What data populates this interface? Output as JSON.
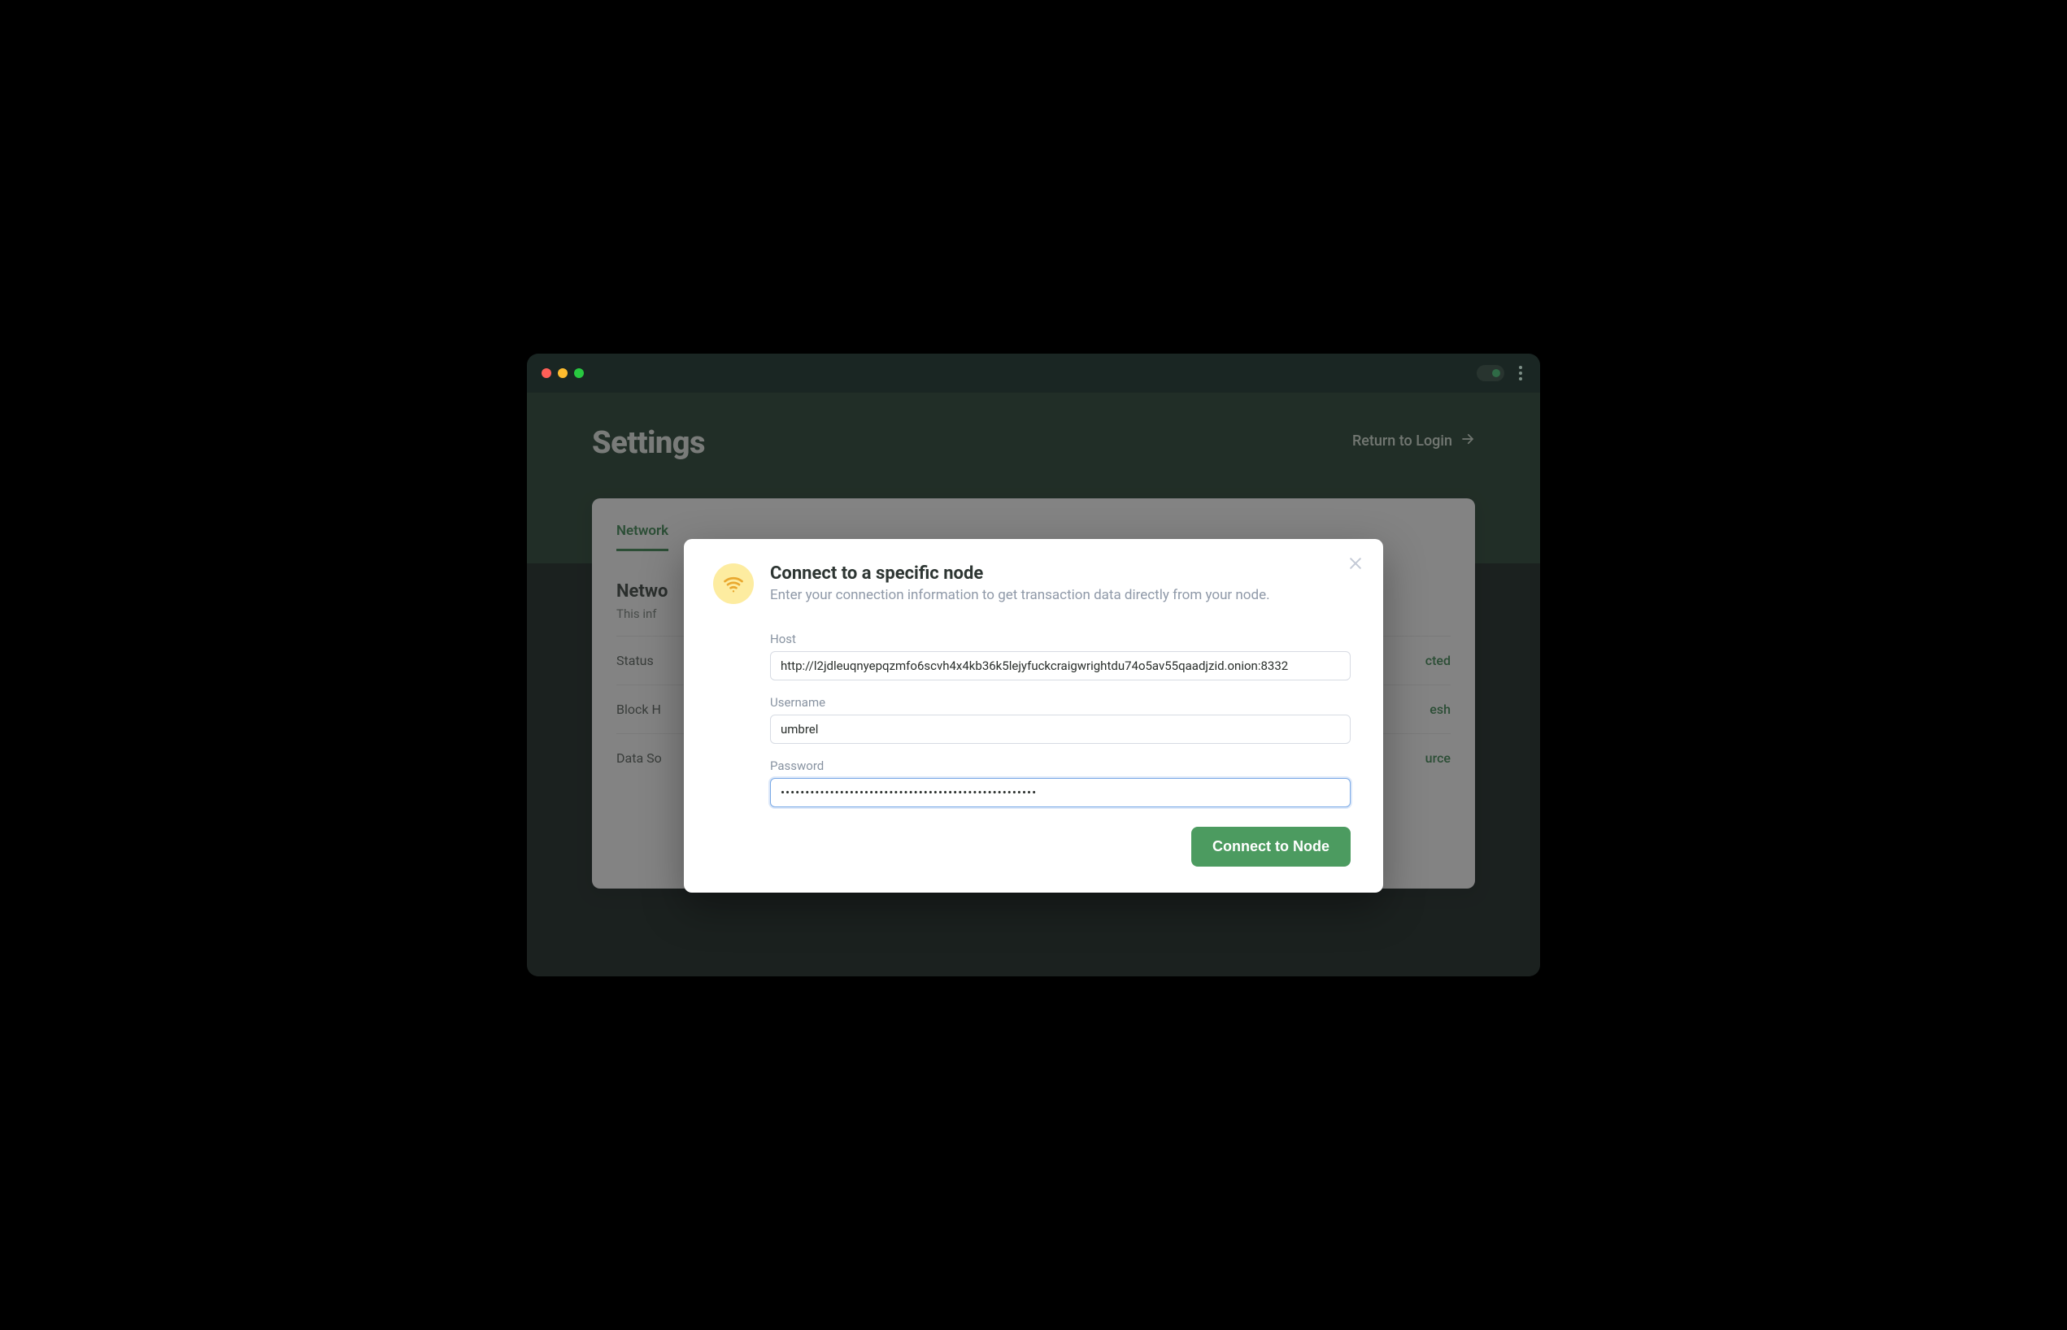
{
  "page": {
    "title": "Settings",
    "return_link": "Return to Login"
  },
  "tabs": {
    "network": "Network"
  },
  "network_panel": {
    "heading_prefix": "Netwo",
    "desc_prefix": "This inf",
    "rows": {
      "status": {
        "label": "Status",
        "value_suffix": "cted"
      },
      "block": {
        "label_prefix": "Block H",
        "value_suffix": "esh"
      },
      "datasource": {
        "label_prefix": "Data So",
        "value_suffix": "urce"
      }
    }
  },
  "modal": {
    "title": "Connect to a specific node",
    "subtitle": "Enter your connection information to get transaction data directly from your node.",
    "fields": {
      "host": {
        "label": "Host",
        "value": "http://l2jdleuqnyepqzmfo6scvh4x4kb36k5lejyfuckcraigwrightdu74o5av55qaadjzid.onion:8332"
      },
      "username": {
        "label": "Username",
        "value": "umbrel"
      },
      "password": {
        "label": "Password",
        "value": "••••••••••••••••••••••••••••••••••••••••••••••••••••"
      }
    },
    "submit": "Connect to Node"
  }
}
